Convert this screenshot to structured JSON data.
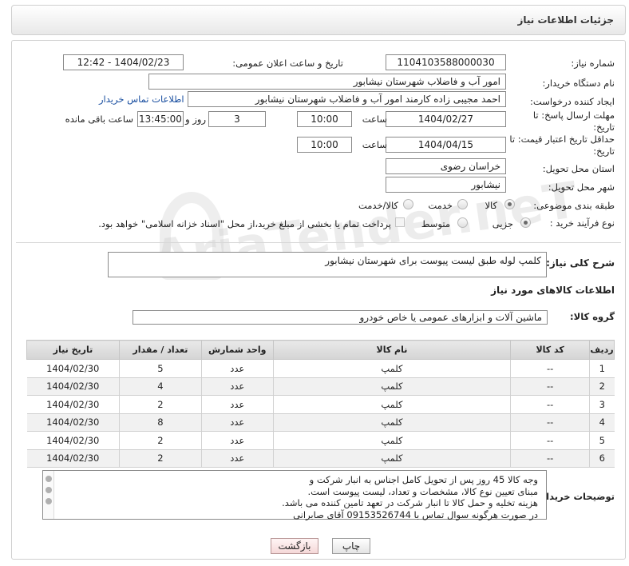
{
  "header": {
    "title": "جزئیات اطلاعات نیاز"
  },
  "form": {
    "need_number_label": "شماره نیاز:",
    "need_number": "1104103588000030",
    "announce_label": "تاریخ و ساعت اعلان عمومی:",
    "announce_value": "1404/02/23 - 12:42",
    "buyer_org_label": "نام دستگاه خریدار:",
    "buyer_org": "امور آب و فاضلاب شهرستان نیشابور",
    "creator_label": "ایجاد کننده درخواست:",
    "creator": "احمد مجیبی زاده کارمند امور آب و فاضلاب شهرستان نیشابور",
    "contact_link": "اطلاعات تماس خریدار",
    "reply_deadline_label": "مهلت ارسال پاسخ: تا تاریخ:",
    "reply_date": "1404/02/27",
    "time_label": "ساعت",
    "reply_time": "10:00",
    "days_value": "3",
    "days_label": "روز و",
    "remaining_time": "13:45:00",
    "remaining_label": "ساعت باقی مانده",
    "validity_label": "حداقل تاریخ اعتبار قیمت: تا تاریخ:",
    "validity_date": "1404/04/15",
    "validity_time": "10:00",
    "province_label": "استان محل تحویل:",
    "province": "خراسان رضوی",
    "city_label": "شهر محل تحویل:",
    "city": "نیشابور",
    "category_label": "طبقه بندی موضوعی:",
    "category_options": [
      "کالا",
      "خدمت",
      "کالا/خدمت"
    ],
    "process_label": "نوع فرآیند خرید :",
    "process_options": [
      "جزیی",
      "متوسط"
    ],
    "treasury_note": "پرداخت تمام یا بخشی از مبلغ خرید،از محل \"اسناد خزانه اسلامی\" خواهد بود.",
    "summary_label": "شرح کلی نیاز:",
    "summary": "کلمپ لوله طبق لیست پیوست برای شهرستان نیشابور",
    "goods_section": "اطلاعات کالاهای مورد نیاز",
    "goods_group_label": "گروه کالا:",
    "goods_group": "ماشین آلات و ابزارهای عمومی یا خاص خودرو",
    "watermark": "AriaTender.neT"
  },
  "table": {
    "headers": [
      "ردیف",
      "کد کالا",
      "نام کالا",
      "واحد شمارش",
      "تعداد / مقدار",
      "تاریخ نیاز"
    ],
    "rows": [
      [
        "1",
        "--",
        "کلمپ",
        "عدد",
        "5",
        "1404/02/30"
      ],
      [
        "2",
        "--",
        "کلمپ",
        "عدد",
        "4",
        "1404/02/30"
      ],
      [
        "3",
        "--",
        "کلمپ",
        "عدد",
        "2",
        "1404/02/30"
      ],
      [
        "4",
        "--",
        "کلمپ",
        "عدد",
        "8",
        "1404/02/30"
      ],
      [
        "5",
        "--",
        "کلمپ",
        "عدد",
        "2",
        "1404/02/30"
      ],
      [
        "6",
        "--",
        "کلمپ",
        "عدد",
        "2",
        "1404/02/30"
      ]
    ]
  },
  "notes": {
    "label": "توضیحات خریدار:",
    "lines": [
      "وجه کالا 45 روز پس از تحویل کامل اجناس به انبار شرکت و",
      "مبنای تعیین نوع کالا، مشخصات و تعداد، لیست پیوست است.",
      "هزینه تخلیه و حمل کالا تا انبار شرکت در تعهد تامین کننده می باشد.",
      "در صورت هرگونه سوال تماس با 09153526744 آقای صابرانی"
    ]
  },
  "buttons": {
    "print": "چاپ",
    "back": "بازگشت"
  }
}
